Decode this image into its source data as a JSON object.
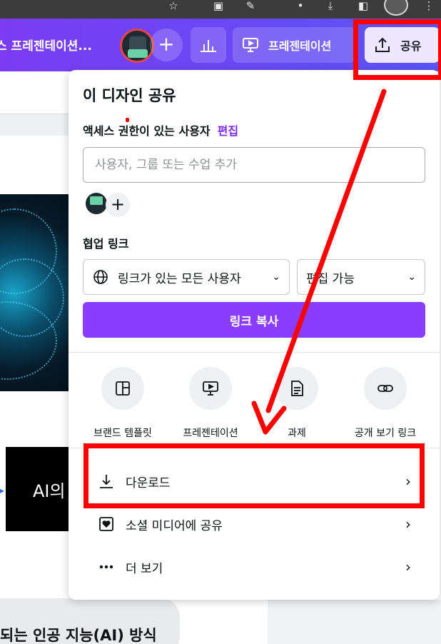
{
  "toolbar": {
    "doc_title": "스 프레젠테이션...",
    "add_label": "+",
    "present_label": "프레젠테이션",
    "share_label": "공유"
  },
  "share_panel": {
    "title": "이 디자인 공유",
    "access_label": "액세스 권한이 있는 사용자",
    "access_edit": "편집",
    "people_placeholder": "사용자, 그룹 또는 수업 추가",
    "add_member": "+",
    "collab_label": "협업 링크",
    "link_access": "링크가 있는 모든 사용자",
    "link_permission": "편집 가능",
    "copy_link": "링크 복사",
    "quick_actions": [
      {
        "label": "브랜드 템플릿",
        "icon": "brand-template-icon"
      },
      {
        "label": "프레젠테이션",
        "icon": "presentation-icon"
      },
      {
        "label": "과제",
        "icon": "assignment-icon"
      },
      {
        "label": "공개 보기 링크",
        "icon": "link-icon"
      }
    ],
    "menu": [
      {
        "label": "다운로드",
        "icon": "download-icon"
      },
      {
        "label": "소셜 미디어에 공유",
        "icon": "heart-icon"
      },
      {
        "label": "더 보기",
        "icon": "more-icon"
      }
    ]
  },
  "background": {
    "card_text": "AI의",
    "bottom_text": "되는 인공 지능(AI) 방식"
  },
  "colors": {
    "accent": "#8b3dff",
    "toolbar_start": "#7b3cf2",
    "toolbar_end": "#5b55f7",
    "annotation": "#ff0000"
  }
}
